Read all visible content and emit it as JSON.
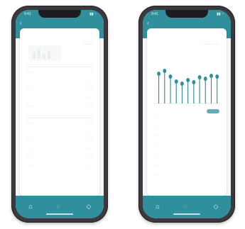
{
  "colors": {
    "brand": "#2f8f9c",
    "screen_bg": "#f4f6f6",
    "card_bg": "#ffffff",
    "text_muted": "#b6bfc0"
  },
  "left": {
    "status": {
      "time": "9:41",
      "icons": "▮▮ ◔"
    },
    "header": {
      "back_icon": "chevron-left-icon",
      "title": "··········"
    },
    "rows": [
      {
        "k": "···· ····",
        "v": "·· ··"
      },
      {
        "k": "····",
        "v": "·····"
      },
      {
        "k": "······",
        "v": "·· ·····"
      },
      {
        "k": "····",
        "v": "·········"
      },
      {
        "k": "······ ···",
        "v": "·· ····"
      },
      {
        "k": "········",
        "v": "·····"
      },
      {
        "k": "··",
        "v": "·· ···"
      },
      {
        "k": "······",
        "v": "·····"
      },
      {
        "k": "··· ····",
        "v": "········"
      },
      {
        "k": "·····",
        "v": "·· ·····"
      },
      {
        "k": "······",
        "v": "··· ··"
      }
    ],
    "tabbar": {
      "icons": [
        "home-icon",
        "compass-icon",
        "bell-icon"
      ]
    }
  },
  "right": {
    "status": {
      "time": "9:41",
      "icons": "▮▮ ◔"
    },
    "header": {
      "back_icon": "chevron-left-icon",
      "title": "·········· ·······"
    },
    "chart_label": "·····",
    "menu": [
      "······",
      "····",
      "······",
      "····",
      "·····",
      "······",
      "·····"
    ],
    "tabbar": {
      "icons": [
        "home-icon",
        "compass-icon",
        "bell-icon"
      ]
    }
  }
}
